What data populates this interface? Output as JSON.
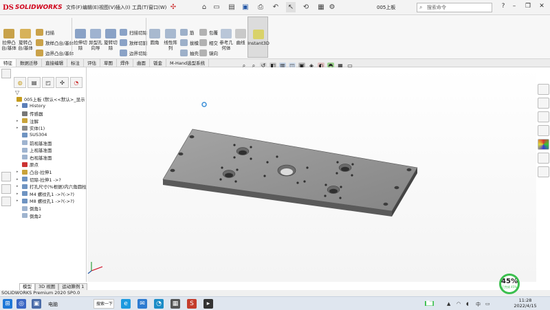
{
  "app": {
    "logo_ds": "DS",
    "logo_text": "SOLIDWORKS",
    "document_title": "005上板",
    "search_placeholder": "搜索命令"
  },
  "menu": [
    {
      "label": "文件(F)"
    },
    {
      "label": "编辑(E)"
    },
    {
      "label": "视图(V)"
    },
    {
      "label": "插入(I)"
    },
    {
      "label": "工具(T)"
    },
    {
      "label": "窗口(W)"
    }
  ],
  "ribbon": {
    "big_buttons": [
      {
        "label": "拉伸凸台/基体",
        "icon": "extrude-boss-icon"
      },
      {
        "label": "旋转凸台/基体",
        "icon": "revolve-boss-icon"
      },
      {
        "label": "拉伸切除",
        "icon": "extrude-cut-icon"
      },
      {
        "label": "异型孔向导",
        "icon": "hole-wizard-icon"
      },
      {
        "label": "旋转切除",
        "icon": "revolve-cut-icon"
      },
      {
        "label": "圆角",
        "icon": "fillet-icon"
      },
      {
        "label": "线性阵列",
        "icon": "linear-pattern-icon"
      },
      {
        "label": "参考几何体",
        "icon": "reference-geometry-icon"
      },
      {
        "label": "曲线",
        "icon": "curves-icon"
      },
      {
        "label": "Instant3D",
        "icon": "instant3d-icon"
      }
    ],
    "small_buttons": [
      {
        "label": "扫描",
        "icon": "sweep-icon"
      },
      {
        "label": "放样凸台/基体",
        "icon": "loft-boss-icon"
      },
      {
        "label": "边界凸台/基体",
        "icon": "boundary-boss-icon"
      },
      {
        "label": "扫描切除",
        "icon": "swept-cut-icon"
      },
      {
        "label": "放样切割",
        "icon": "lofted-cut-icon"
      },
      {
        "label": "边界切除",
        "icon": "boundary-cut-icon"
      },
      {
        "label": "筋",
        "icon": "rib-icon"
      },
      {
        "label": "拔模",
        "icon": "draft-icon"
      },
      {
        "label": "抽壳",
        "icon": "shell-icon"
      },
      {
        "label": "包覆",
        "icon": "wrap-icon"
      },
      {
        "label": "相交",
        "icon": "intersect-icon"
      },
      {
        "label": "镜向",
        "icon": "mirror-icon"
      }
    ]
  },
  "tabs": [
    {
      "label": "特征",
      "active": true
    },
    {
      "label": "数据迁移"
    },
    {
      "label": "直接编辑"
    },
    {
      "label": "标注"
    },
    {
      "label": "评估"
    },
    {
      "label": "草图"
    },
    {
      "label": "焊件"
    },
    {
      "label": "曲面"
    },
    {
      "label": "钣金"
    },
    {
      "label": "M-Hand选型系统"
    }
  ],
  "tree": [
    {
      "label": "005上板 (默认<<默认>_显示",
      "icon": "part-icon",
      "indent": 0,
      "expander": ""
    },
    {
      "label": "History",
      "icon": "history-icon",
      "indent": 1,
      "expander": "▸"
    },
    {
      "label": "传感器",
      "icon": "sensor-icon",
      "indent": 1,
      "expander": ""
    },
    {
      "label": "注解",
      "icon": "annotation-icon",
      "indent": 1,
      "expander": "▸"
    },
    {
      "label": "实体(1)",
      "icon": "solid-bodies-icon",
      "indent": 1,
      "expander": "▸"
    },
    {
      "label": "SUS304",
      "icon": "material-icon",
      "indent": 1,
      "expander": ""
    },
    {
      "label": "前视基准面",
      "icon": "plane-icon",
      "indent": 1,
      "expander": ""
    },
    {
      "label": "上视基准面",
      "icon": "plane-icon",
      "indent": 1,
      "expander": ""
    },
    {
      "label": "右视基准面",
      "icon": "plane-icon",
      "indent": 1,
      "expander": ""
    },
    {
      "label": "原点",
      "icon": "origin-icon",
      "indent": 1,
      "expander": ""
    },
    {
      "label": "凸台-拉伸1",
      "icon": "extrude-feature-icon",
      "indent": 1,
      "expander": "▸"
    },
    {
      "label": "切除-拉伸1 ->?",
      "icon": "cut-feature-icon",
      "indent": 1,
      "expander": "▸"
    },
    {
      "label": "打孔尺寸(%根据)内六角圆柱",
      "icon": "hole-feature-icon",
      "indent": 1,
      "expander": "▸"
    },
    {
      "label": "M4 螺纹孔1 ->?(->?)",
      "icon": "hole-feature-icon",
      "indent": 1,
      "expander": "▸"
    },
    {
      "label": "M8 螺纹孔1 ->?(->?)",
      "icon": "hole-feature-icon",
      "indent": 1,
      "expander": "▸"
    },
    {
      "label": "倒角1",
      "icon": "chamfer-icon",
      "indent": 1,
      "expander": ""
    },
    {
      "label": "倒角2",
      "icon": "chamfer-icon",
      "indent": 1,
      "expander": ""
    }
  ],
  "bottom_tabs": [
    {
      "label": "模型"
    },
    {
      "label": "3D 视图"
    },
    {
      "label": "运动算例 1"
    }
  ],
  "status": {
    "text": "SOLIDWORKS Premium 2020 SP0.0"
  },
  "zoom": {
    "percent": "45%",
    "sub": "已完成 45%"
  },
  "taskbar": {
    "weather": "电脑",
    "search": "搜索一下",
    "time": "11:28",
    "date": "2022/4/15"
  },
  "colors": {
    "brand_red": "#d0021b",
    "part_gray": "#8f8f8f",
    "zoom_green": "#3bbf4e"
  }
}
